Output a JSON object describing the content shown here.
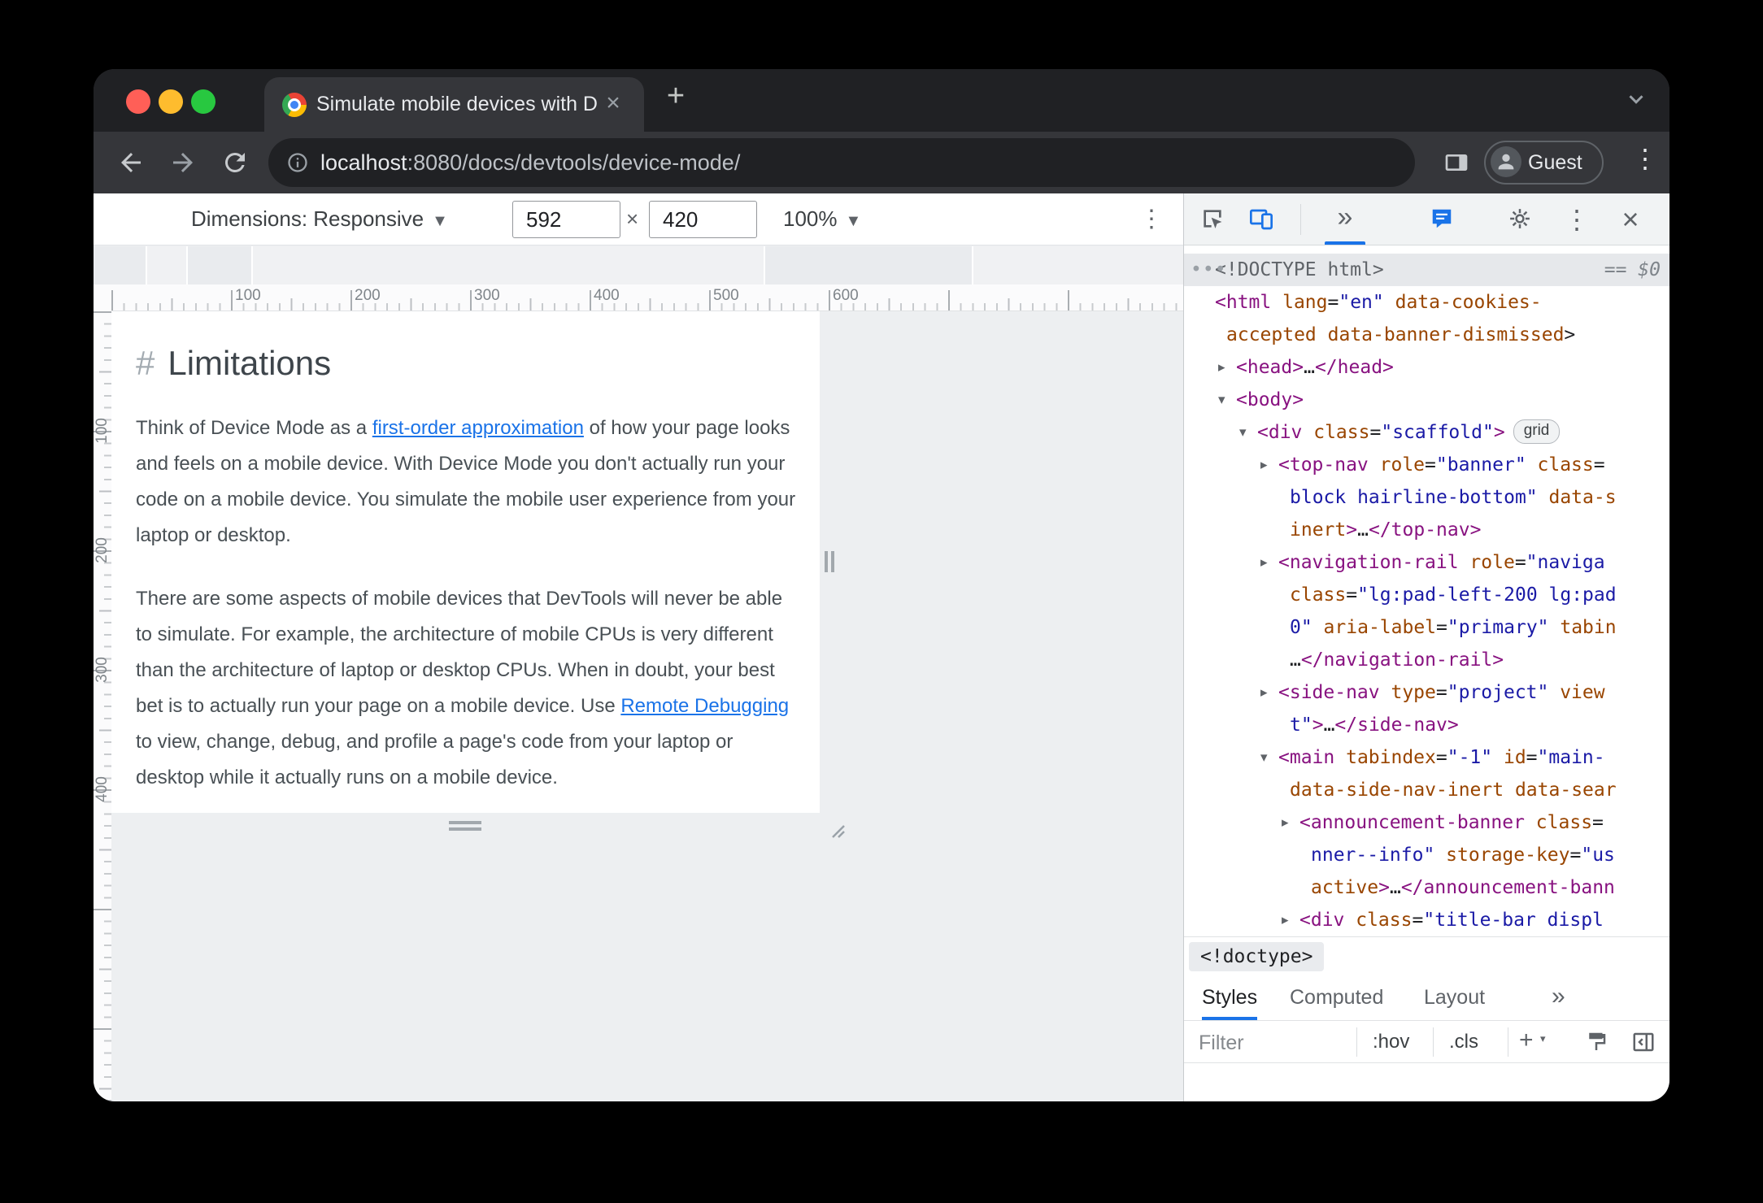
{
  "browser": {
    "tab_title": "Simulate mobile devices with D",
    "profile_label": "Guest",
    "url": {
      "host": "localhost",
      "path": ":8080/docs/devtools/device-mode/"
    }
  },
  "device_toolbar": {
    "dimensions_label": "Dimensions: Responsive",
    "width_value": "592",
    "height_value": "420",
    "times_separator": "×",
    "zoom_value": "100%"
  },
  "rulers": {
    "h": [
      "100",
      "200",
      "300",
      "400",
      "500",
      "600"
    ],
    "v": [
      "100",
      "200",
      "300",
      "400"
    ]
  },
  "doc": {
    "heading_marker": "#",
    "heading": "Limitations",
    "p1": {
      "before": "Think of Device Mode as a ",
      "link": "first-order approximation",
      "after": " of how your page looks and feels on a mobile device. With Device Mode you don't actually run your code on a mobile device. You simulate the mobile user experience from your laptop or desktop."
    },
    "p2": {
      "before": "There are some aspects of mobile devices that DevTools will never be able to simulate. For example, the architecture of mobile CPUs is very different than the architecture of laptop or desktop CPUs. When in doubt, your best bet is to actually run your page on a mobile device. Use ",
      "link": "Remote Debugging",
      "after": " to view, change, debug, and profile a page's code from your laptop or desktop while it actually runs on a mobile device."
    }
  },
  "devtools": {
    "selected_hint": "== $0",
    "grid_badge": "grid",
    "breadcrumb_item": "<!doctype>",
    "sidebar_tabs": [
      "Styles",
      "Computed",
      "Layout"
    ],
    "filter_placeholder": "Filter",
    "pseudo_state_label": ":hov",
    "class_toggle_label": ".cls",
    "tree": {
      "r0": [
        "•••",
        "<!DOCTYPE html>"
      ],
      "r1": [
        "<html",
        " lang",
        "=",
        "\"en\"",
        " data-cookies-"
      ],
      "r2": [
        "accepted",
        " data-banner-dismissed",
        ">"
      ],
      "r3": [
        "<head>",
        "…",
        "</head>"
      ],
      "r4": [
        "<body>"
      ],
      "r5": [
        "<div",
        " class",
        "=",
        "\"scaffold\"",
        ">"
      ],
      "r6": [
        "<top-nav",
        " role",
        "=",
        "\"banner\"",
        " class",
        "="
      ],
      "r7": [
        "block hairline-bottom\"",
        " data-s"
      ],
      "r8": [
        "inert",
        ">",
        "…",
        "</top-nav>"
      ],
      "r9": [
        "<navigation-rail",
        " role",
        "=",
        "\"naviga"
      ],
      "r10": [
        "class",
        "=",
        "\"lg:pad-left-200 lg:pad"
      ],
      "r11": [
        "0\"",
        " aria-label",
        "=",
        "\"primary\"",
        " tabin"
      ],
      "r12": [
        "…",
        "</navigation-rail>"
      ],
      "r13": [
        "<side-nav",
        " type",
        "=",
        "\"project\"",
        " view"
      ],
      "r14": [
        "t\"",
        ">",
        "…",
        "</side-nav>"
      ],
      "r15": [
        "<main",
        " tabindex",
        "=",
        "\"-1\"",
        " id",
        "=",
        "\"main-"
      ],
      "r16": [
        "data-side-nav-inert",
        " data-sear"
      ],
      "r17": [
        "<announcement-banner",
        " class",
        "="
      ],
      "r18": [
        "nner--info\"",
        " storage-key",
        "=",
        "\"us"
      ],
      "r19": [
        "active",
        ">",
        "…",
        "</announcement-bann"
      ],
      "r20": [
        "<div",
        " class",
        "=",
        "\"title-bar displ"
      ]
    }
  }
}
